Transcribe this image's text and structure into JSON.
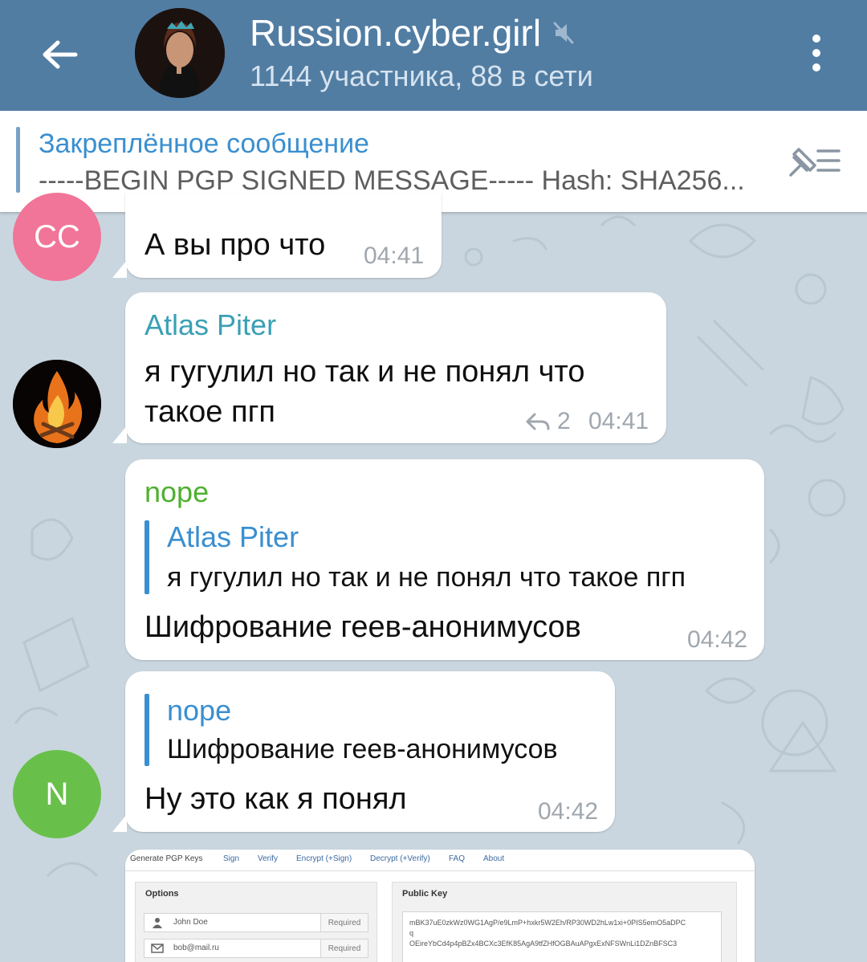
{
  "header": {
    "title": "Russion.cyber.girl",
    "subtitle": "1144 участника, 88 в сети",
    "colors": {
      "bar": "#527da3",
      "title": "#ffffff",
      "subtitle": "#d6e3ef"
    }
  },
  "pinned": {
    "title": "Закреплённое сообщение",
    "text": "-----BEGIN PGP SIGNED MESSAGE----- Hash: SHA256..."
  },
  "messages": [
    {
      "avatar_text": "CC",
      "avatar_color": "#f07598",
      "text": "А вы про что",
      "time": "04:41"
    },
    {
      "sender": "Atlas Piter",
      "sender_color": "#3aa0b5",
      "lines": [
        "я гугулил но так и  не понял что",
        "такое пгп"
      ],
      "reply_count": "2",
      "time": "04:41"
    },
    {
      "sender": "nope",
      "sender_color": "#4eb02e",
      "quote": {
        "name": "Atlas Piter",
        "text": "я гугулил но так и  не понял что такое пгп"
      },
      "text": "Шифрование геев-анонимусов",
      "time": "04:42"
    },
    {
      "avatar_text": "N",
      "avatar_color": "#68c04a",
      "quote": {
        "name": "nope",
        "text": "Шифрование геев-анонимусов"
      },
      "text": "Ну это как я понял",
      "time": "04:42"
    }
  ],
  "screenshot": {
    "tabs": [
      "Generate PGP Keys",
      "Sign",
      "Verify",
      "Encrypt (+Sign)",
      "Decrypt (+Verify)",
      "FAQ",
      "About"
    ],
    "options_title": "Options",
    "name_field": "John Doe",
    "email_field": "bob@mail.ru",
    "required_label": "Required",
    "public_key_title": "Public Key",
    "key_lines": [
      "mBK37uE0zkWz0WG1AgP/e9LmP+hxkr5W2Eh/RP30WD2hLw1xi+0PIS5emO5aDPC",
      "q",
      "OEireYbCd4p4pBZx4BCXc3EfK85AgA9tfZHfOGBAuAPgxExNFSWnLi1DZnBFSC3"
    ]
  },
  "icons": {
    "back": "arrow-left-icon",
    "mute": "muted-speaker-icon",
    "menu": "more-vertical-icon",
    "pin_list": "pin-list-icon",
    "reply": "reply-arrow-icon"
  }
}
